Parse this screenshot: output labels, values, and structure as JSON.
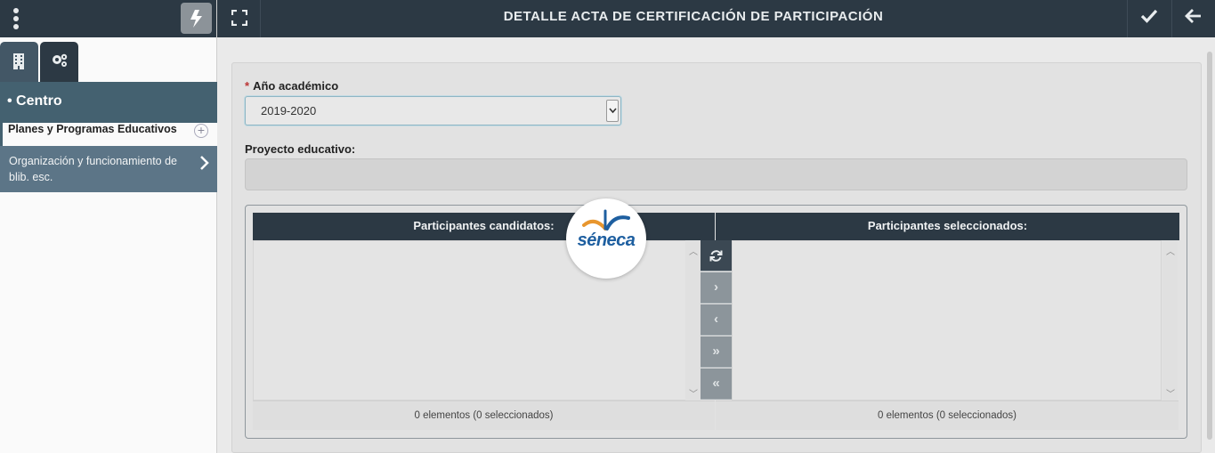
{
  "header": {
    "title": "DETALLE ACTA DE CERTIFICACIÓN DE PARTICIPACIÓN",
    "icons": [
      "expand-icon",
      "check-icon",
      "arrow-left-icon"
    ]
  },
  "sidebar": {
    "top_icons": [
      "kebab-menu-icon",
      "bolt-icon"
    ],
    "tabs": [
      {
        "icon": "building-icon"
      },
      {
        "icon": "gears-icon"
      }
    ],
    "section_title": "• Centro",
    "items": [
      {
        "label": "Planes y Programas Educativos",
        "icon": "plus-circle-icon"
      },
      {
        "label": "Organización y funcionamiento de blib. esc.",
        "icon": "chevron-right-icon"
      }
    ]
  },
  "form": {
    "academic_year_label": "Año académico",
    "academic_year_required_mark": "*",
    "academic_year_value": "2019-2020",
    "project_label": "Proyecto educativo:",
    "project_value": ""
  },
  "dual_list": {
    "left_header": "Participantes candidatos:",
    "right_header": "Participantes seleccionados:",
    "left_footer": "0 elementos (0 seleccionados)",
    "right_footer": "0 elementos (0 seleccionados)",
    "buttons": [
      {
        "icon": "refresh-icon"
      },
      {
        "icon": "move-right-icon",
        "glyph": "›"
      },
      {
        "icon": "move-left-icon",
        "glyph": "‹"
      },
      {
        "icon": "move-all-right-icon",
        "glyph": "»"
      },
      {
        "icon": "move-all-left-icon",
        "glyph": "«"
      }
    ]
  },
  "logo": {
    "text": "séneca"
  },
  "colors": {
    "header_bg": "#2c3944",
    "section_bg": "#446170",
    "active_item_bg": "#5c7587",
    "logo_blue": "#1e5fa0",
    "logo_orange": "#e8962e"
  }
}
